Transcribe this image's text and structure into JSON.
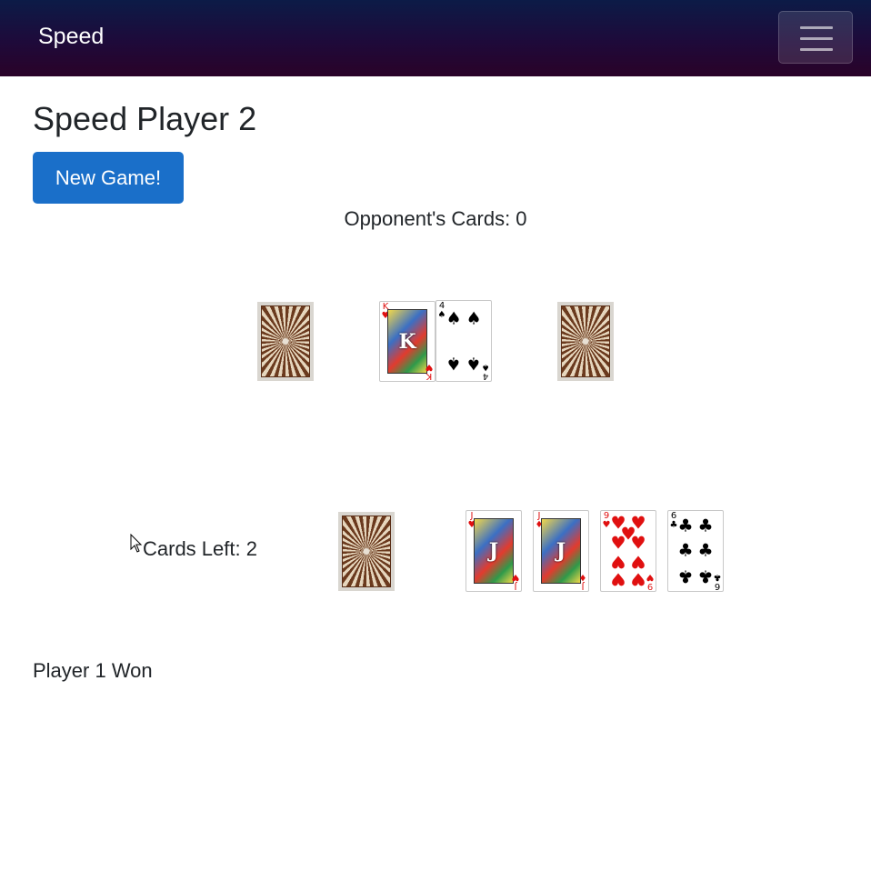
{
  "navbar": {
    "brand": "Speed",
    "menu_icon": "hamburger-menu-icon"
  },
  "page": {
    "title": "Speed Player 2",
    "new_game_label": "New Game!"
  },
  "opponent": {
    "label": "Opponent's Cards: 0"
  },
  "player": {
    "cards_left_label": "Cards Left: 2"
  },
  "status": {
    "message": "Player 1 Won"
  },
  "colors": {
    "button": "#1a6fc9",
    "navbar_top": "#0c1b47",
    "navbar_bottom": "#2a0228",
    "red_suit": "#e01010"
  },
  "table": {
    "left_stock": {
      "face": "down"
    },
    "center_left_pile": {
      "rank": "K",
      "suit": "♥",
      "suit_name": "hearts"
    },
    "center_right_pile": {
      "rank": "4",
      "suit": "♠",
      "suit_name": "spades"
    },
    "right_stock": {
      "face": "down"
    }
  },
  "hand": {
    "draw_pile": {
      "face": "down"
    },
    "cards": [
      {
        "rank": "J",
        "suit": "♥",
        "suit_name": "hearts"
      },
      {
        "rank": "J",
        "suit": "♦",
        "suit_name": "diamonds"
      },
      {
        "rank": "9",
        "suit": "♥",
        "suit_name": "hearts"
      },
      {
        "rank": "6",
        "suit": "♣",
        "suit_name": "clubs"
      }
    ]
  }
}
